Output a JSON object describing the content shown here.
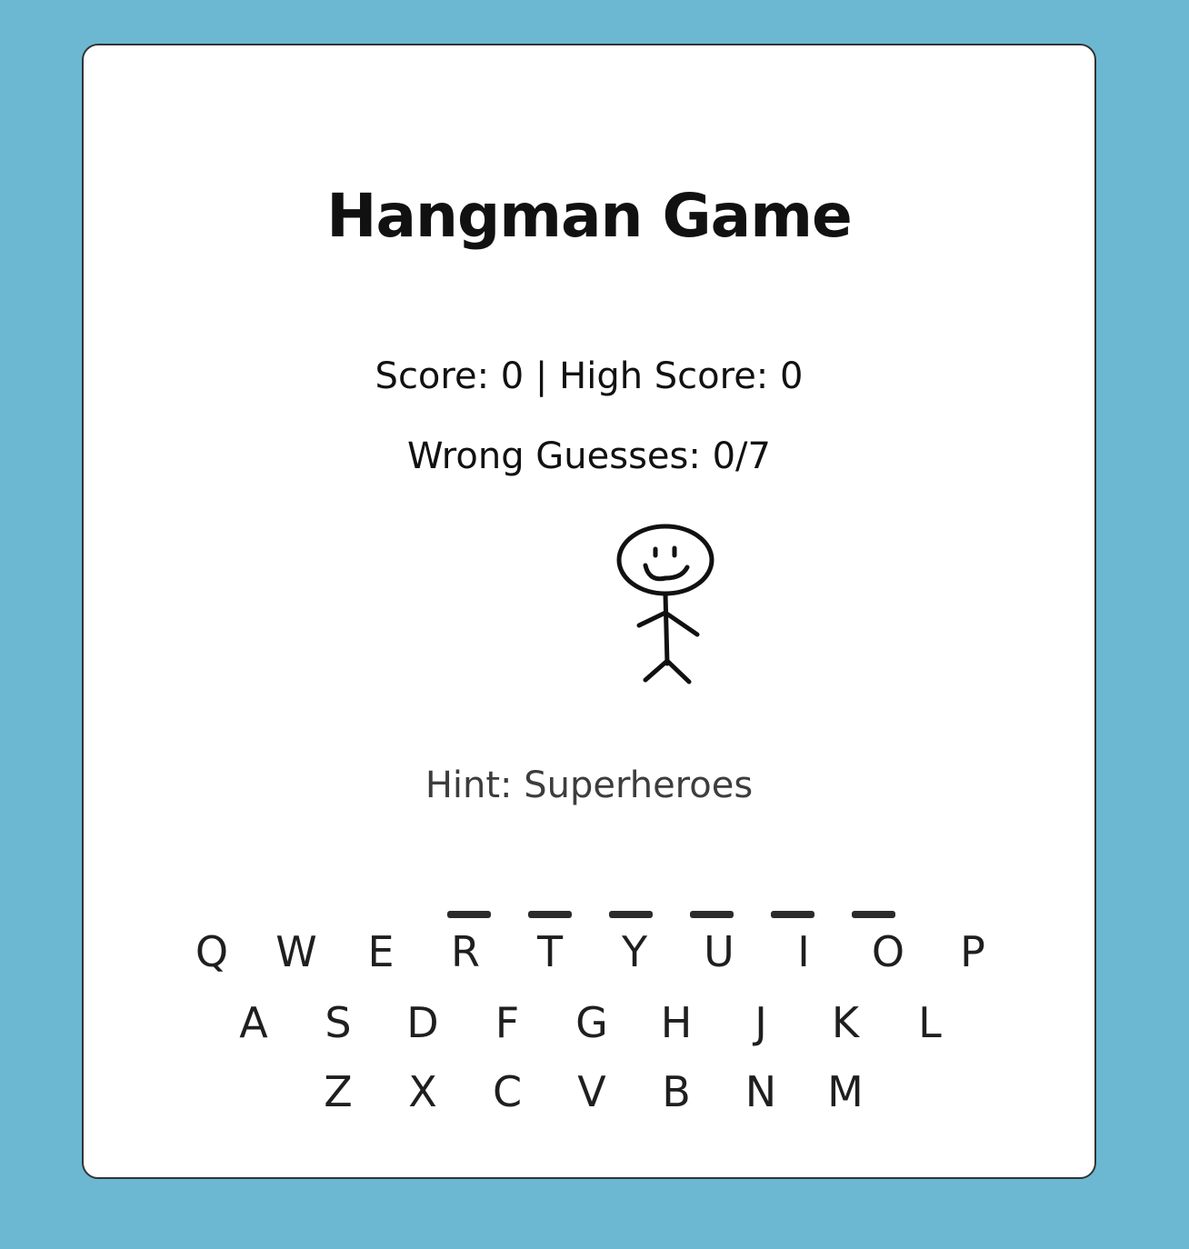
{
  "game": {
    "title": "Hangman Game",
    "score_line": "Score: 0 | High Score: 0",
    "wrong_line": "Wrong Guesses: 0/7",
    "hint": "Hint: Superheroes",
    "score": 0,
    "high_score": 0,
    "wrong_guesses": 0,
    "max_wrong_guesses": 7,
    "word_length": 6
  },
  "keyboard": {
    "rows": [
      [
        "Q",
        "W",
        "E",
        "R",
        "T",
        "Y",
        "U",
        "I",
        "O",
        "P"
      ],
      [
        "A",
        "S",
        "D",
        "F",
        "G",
        "H",
        "J",
        "K",
        "L"
      ],
      [
        "Z",
        "X",
        "C",
        "V",
        "B",
        "N",
        "M"
      ]
    ]
  },
  "colors": {
    "background": "#6cb8d2",
    "card": "#ffffff",
    "text": "#111111",
    "hint": "#3d3d3d"
  }
}
